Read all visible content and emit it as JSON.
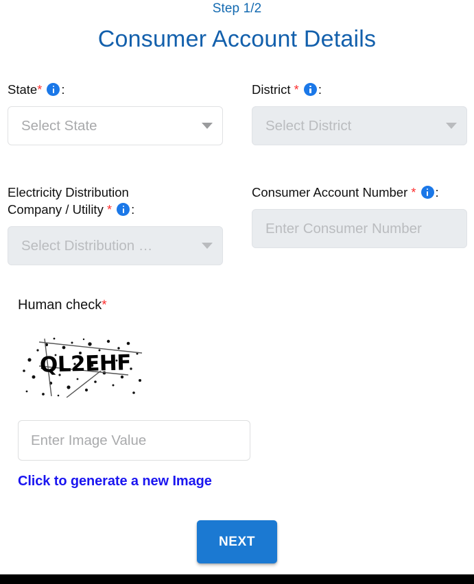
{
  "header": {
    "step": "Step 1/2",
    "title": "Consumer Account Details"
  },
  "colors": {
    "accent_blue": "#1360ac",
    "step_blue": "#1269b0",
    "button_blue": "#1b79d2",
    "link_blue": "#1a15f0",
    "required_red": "#fc2d2d",
    "info_icon_blue": "#1b78e8",
    "disabled_bg": "#e9ecef"
  },
  "fields": {
    "state": {
      "label": "State",
      "required_marker": "*",
      "colon": ":",
      "placeholder": "Select State",
      "disabled": false
    },
    "district": {
      "label": "District",
      "required_marker": "*",
      "colon": ":",
      "placeholder": "Select District",
      "disabled": true
    },
    "distribution_company": {
      "label": "Electricity Distribution Company / Utility",
      "required_marker": "*",
      "colon": ":",
      "placeholder": "Select Distribution …",
      "disabled": true
    },
    "consumer_account_number": {
      "label": "Consumer Account Number",
      "required_marker": "*",
      "colon": ":",
      "placeholder": "Enter Consumer Number",
      "disabled": true
    }
  },
  "captcha": {
    "label": "Human check",
    "required_marker": "*",
    "image_text": "QL2EHF",
    "input_placeholder": "Enter Image Value",
    "regenerate_link": "Click to generate a new Image"
  },
  "actions": {
    "next_label": "NEXT"
  },
  "icons": {
    "info": "info-icon",
    "dropdown": "chevron-down-icon"
  }
}
